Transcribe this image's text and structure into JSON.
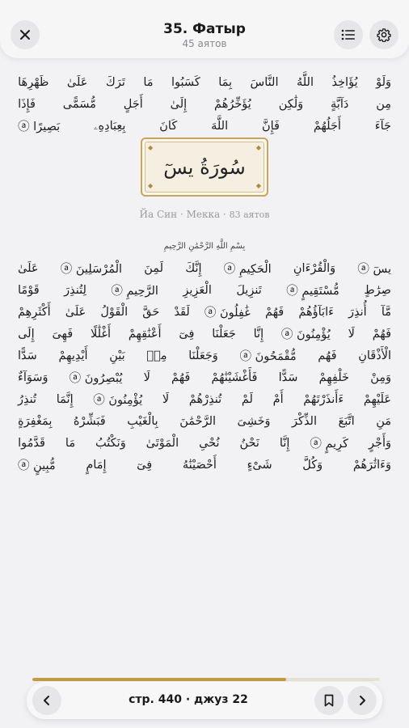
{
  "header": {
    "title": "35. Фатыр",
    "subtitle": "45 аятов",
    "close_icon": "close-icon",
    "list_icon": "list-icon",
    "settings_icon": "gear-icon"
  },
  "top_lines": [
    [
      "وَلَوْ",
      "يُؤَاخِذُ",
      "اللَّهُ",
      "النَّاسَ",
      "بِمَا",
      "كَسَبُوا",
      "مَا",
      "تَرَكَ",
      "عَلَىٰ",
      "ظَهْرِهَا"
    ],
    [
      "مِن",
      "دَآبَّةٍ",
      "وَلَٰكِن",
      "يُؤَخِّرُهُمْ",
      "إِلَىٰ",
      "أَجَلٍ",
      "مُّسَمًّى",
      "فَإِذَا"
    ],
    [
      "جَآءَ",
      "أَجَلُهُمْ",
      "فَإِنَّ",
      "اللَّهَ",
      "كَانَ",
      "بِعِبَادِهِۦ",
      "بَصِيرًا ⓐ"
    ]
  ],
  "surah_header": {
    "name": "سُورَةُ يسٓ",
    "info": "Йа Син · Мекка ·",
    "ayat_count": "83 аятов",
    "bismillah": "بِسْمِ اللَّهِ الرَّحْمَٰنِ الرَّحِيمِ"
  },
  "bottom_lines": [
    [
      "يسٓ ⓐ",
      "وَالْقُرْءَانِ",
      "الْحَكِيمِ ⓐ",
      "إِنَّكَ",
      "لَمِنَ",
      "الْمُرْسَلِينَ ⓐ",
      "عَلَىٰ"
    ],
    [
      "صِرَٰطٍ",
      "مُّسْتَقِيمٍ ⓐ",
      "تَنزِيلَ",
      "الْعَزِيزِ",
      "الرَّحِيمِ ⓐ",
      "لِتُنذِرَ",
      "قَوْمًا"
    ],
    [
      "مَّآ",
      "أُنذِرَ",
      "ءَابَآؤُهُمْ",
      "فَهُمْ",
      "غَٰفِلُونَ ⓐ",
      "لَقَدْ",
      "حَقَّ",
      "الْقَوْلُ",
      "عَلَىٰ",
      "أَكْثَرِهِمْ"
    ],
    [
      "فَهُمْ",
      "لَا",
      "يُؤْمِنُونَ ⓐ",
      "إِنَّا",
      "جَعَلْنَا",
      "فِىٓ",
      "أَعْنَٰقِهِمْ",
      "أَغْلَٰلًا",
      "فَهِىَ",
      "إِلَى"
    ],
    [
      "الْأَذْقَانِ",
      "فَهُم",
      "مُّقْمَحُونَ ⓐ",
      "وَجَعَلْنَا",
      "مِنۢ",
      "بَيْنِ",
      "أَيْدِيهِمْ",
      "سَدًّا"
    ],
    [
      "وَمِنْ",
      "خَلْفِهِمْ",
      "سَدًّا",
      "فَأَغْشَيْنَٰهُمْ",
      "فَهُمْ",
      "لَا",
      "يُبْصِرُونَ ⓐ",
      "وَسَوَآءٌ"
    ],
    [
      "عَلَيْهِمْ",
      "ءَأَنذَرْتَهُمْ",
      "أَمْ",
      "لَمْ",
      "تُنذِرْهُمْ",
      "لَا",
      "يُؤْمِنُونَ ⓐ",
      "إِنَّمَا",
      "تُنذِرُ"
    ],
    [
      "مَنِ",
      "اتَّبَعَ",
      "الذِّكْرَ",
      "وَخَشِىَ",
      "الرَّحْمَٰنَ",
      "بِالْغَيْبِ",
      "فَبَشِّرْهُ",
      "بِمَغْفِرَةٍ"
    ],
    [
      "وَأَجْرٍ",
      "كَرِيمٍ ⓐ",
      "إِنَّا",
      "نَحْنُ",
      "نُحْىِ",
      "الْمَوْتَىٰ",
      "وَنَكْتُبُ",
      "مَا",
      "قَدَّمُوا"
    ],
    [
      "وَءَاثَٰرَهُمْ",
      "وَكُلَّ",
      "شَىْءٍ",
      "أَحْصَيْنَٰهُ",
      "فِىٓ",
      "إِمَامٍ",
      "مُّبِينٍ ⓐ"
    ]
  ],
  "bottom_bar": {
    "page_label": "стр. 440 · джуз 22",
    "progress_percent": 73,
    "prev_icon": "chevron-left-icon",
    "bookmark_icon": "bookmark-icon",
    "next_icon": "chevron-right-icon"
  },
  "colors": {
    "accent_gold": "#c69a3d",
    "background": "#f2f2f4"
  }
}
